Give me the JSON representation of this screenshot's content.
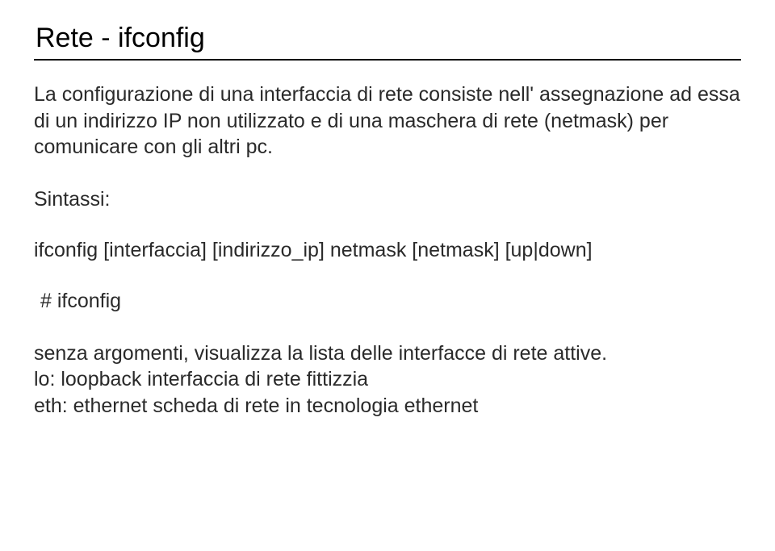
{
  "title": "Rete - ifconfig",
  "intro": "La configurazione di una interfaccia di rete consiste nell' assegnazione ad essa di un indirizzo IP non utilizzato e di una maschera di rete (netmask) per comunicare con gli altri pc.",
  "syntax_label": "Sintassi:",
  "syntax_line": "ifconfig [interfaccia] [indirizzo_ip] netmask [netmask] [up|down]",
  "command": "# ifconfig",
  "desc_line1": "senza argomenti, visualizza la lista delle interfacce di rete attive.",
  "desc_line2": "lo: loopback  interfaccia di rete fittizzia",
  "desc_line3": "eth: ethernet scheda di rete in tecnologia ethernet"
}
